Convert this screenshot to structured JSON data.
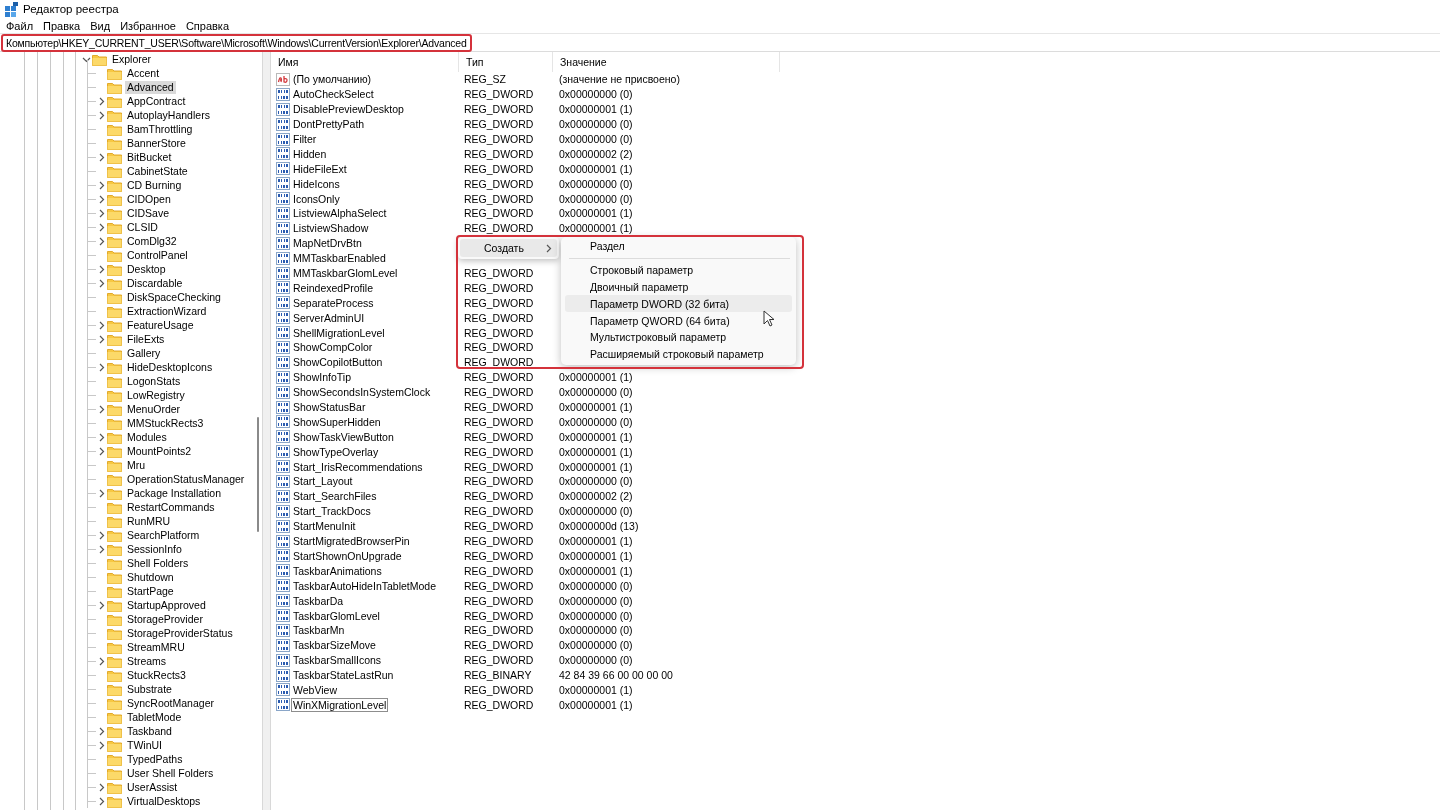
{
  "window": {
    "title": "Редактор реестра"
  },
  "menu": [
    "Файл",
    "Правка",
    "Вид",
    "Избранное",
    "Справка"
  ],
  "address_bar": {
    "path": "Компьютер\\HKEY_CURRENT_USER\\Software\\Microsoft\\Windows\\CurrentVersion\\Explorer\\Advanced",
    "highlighted": true
  },
  "tree": {
    "items": [
      {
        "label": "Explorer",
        "expandable": true,
        "expanded": true,
        "selected": false,
        "children": [
          {
            "label": "Accent",
            "expandable": false,
            "selected": false
          },
          {
            "label": "Advanced",
            "expandable": false,
            "selected": true
          },
          {
            "label": "AppContract",
            "expandable": true,
            "selected": false
          },
          {
            "label": "AutoplayHandlers",
            "expandable": true,
            "selected": false
          },
          {
            "label": "BamThrottling",
            "expandable": false,
            "selected": false
          },
          {
            "label": "BannerStore",
            "expandable": false,
            "selected": false
          },
          {
            "label": "BitBucket",
            "expandable": true,
            "selected": false
          },
          {
            "label": "CabinetState",
            "expandable": false,
            "selected": false
          },
          {
            "label": "CD Burning",
            "expandable": true,
            "selected": false
          },
          {
            "label": "CIDOpen",
            "expandable": true,
            "selected": false
          },
          {
            "label": "CIDSave",
            "expandable": true,
            "selected": false
          },
          {
            "label": "CLSID",
            "expandable": true,
            "selected": false
          },
          {
            "label": "ComDlg32",
            "expandable": true,
            "selected": false
          },
          {
            "label": "ControlPanel",
            "expandable": false,
            "selected": false
          },
          {
            "label": "Desktop",
            "expandable": true,
            "selected": false
          },
          {
            "label": "Discardable",
            "expandable": true,
            "selected": false
          },
          {
            "label": "DiskSpaceChecking",
            "expandable": false,
            "selected": false
          },
          {
            "label": "ExtractionWizard",
            "expandable": false,
            "selected": false
          },
          {
            "label": "FeatureUsage",
            "expandable": true,
            "selected": false
          },
          {
            "label": "FileExts",
            "expandable": true,
            "selected": false
          },
          {
            "label": "Gallery",
            "expandable": false,
            "selected": false
          },
          {
            "label": "HideDesktopIcons",
            "expandable": true,
            "selected": false
          },
          {
            "label": "LogonStats",
            "expandable": false,
            "selected": false
          },
          {
            "label": "LowRegistry",
            "expandable": false,
            "selected": false
          },
          {
            "label": "MenuOrder",
            "expandable": true,
            "selected": false
          },
          {
            "label": "MMStuckRects3",
            "expandable": false,
            "selected": false
          },
          {
            "label": "Modules",
            "expandable": true,
            "selected": false
          },
          {
            "label": "MountPoints2",
            "expandable": true,
            "selected": false
          },
          {
            "label": "Mru",
            "expandable": false,
            "selected": false
          },
          {
            "label": "OperationStatusManager",
            "expandable": false,
            "selected": false
          },
          {
            "label": "Package Installation",
            "expandable": true,
            "selected": false
          },
          {
            "label": "RestartCommands",
            "expandable": false,
            "selected": false
          },
          {
            "label": "RunMRU",
            "expandable": false,
            "selected": false
          },
          {
            "label": "SearchPlatform",
            "expandable": true,
            "selected": false
          },
          {
            "label": "SessionInfo",
            "expandable": true,
            "selected": false
          },
          {
            "label": "Shell Folders",
            "expandable": false,
            "selected": false
          },
          {
            "label": "Shutdown",
            "expandable": false,
            "selected": false
          },
          {
            "label": "StartPage",
            "expandable": false,
            "selected": false
          },
          {
            "label": "StartupApproved",
            "expandable": true,
            "selected": false
          },
          {
            "label": "StorageProvider",
            "expandable": false,
            "selected": false
          },
          {
            "label": "StorageProviderStatus",
            "expandable": false,
            "selected": false
          },
          {
            "label": "StreamMRU",
            "expandable": false,
            "selected": false
          },
          {
            "label": "Streams",
            "expandable": true,
            "selected": false
          },
          {
            "label": "StuckRects3",
            "expandable": false,
            "selected": false
          },
          {
            "label": "Substrate",
            "expandable": false,
            "selected": false
          },
          {
            "label": "SyncRootManager",
            "expandable": false,
            "selected": false
          },
          {
            "label": "TabletMode",
            "expandable": false,
            "selected": false
          },
          {
            "label": "Taskband",
            "expandable": true,
            "selected": false
          },
          {
            "label": "TWinUI",
            "expandable": true,
            "selected": false
          },
          {
            "label": "TypedPaths",
            "expandable": false,
            "selected": false
          },
          {
            "label": "User Shell Folders",
            "expandable": false,
            "selected": false
          },
          {
            "label": "UserAssist",
            "expandable": true,
            "selected": false
          },
          {
            "label": "VirtualDesktops",
            "expandable": true,
            "selected": false
          }
        ]
      }
    ]
  },
  "table": {
    "columns": [
      "Имя",
      "Тип",
      "Значение"
    ],
    "rows": [
      {
        "kind": "string",
        "name": "(По умолчанию)",
        "type": "REG_SZ",
        "value": "(значение не присвоено)",
        "focused": false
      },
      {
        "kind": "binary",
        "name": "AutoCheckSelect",
        "type": "REG_DWORD",
        "value": "0x00000000 (0)",
        "focused": false
      },
      {
        "kind": "binary",
        "name": "DisablePreviewDesktop",
        "type": "REG_DWORD",
        "value": "0x00000001 (1)",
        "focused": false
      },
      {
        "kind": "binary",
        "name": "DontPrettyPath",
        "type": "REG_DWORD",
        "value": "0x00000000 (0)",
        "focused": false
      },
      {
        "kind": "binary",
        "name": "Filter",
        "type": "REG_DWORD",
        "value": "0x00000000 (0)",
        "focused": false
      },
      {
        "kind": "binary",
        "name": "Hidden",
        "type": "REG_DWORD",
        "value": "0x00000002 (2)",
        "focused": false
      },
      {
        "kind": "binary",
        "name": "HideFileExt",
        "type": "REG_DWORD",
        "value": "0x00000001 (1)",
        "focused": false
      },
      {
        "kind": "binary",
        "name": "HideIcons",
        "type": "REG_DWORD",
        "value": "0x00000000 (0)",
        "focused": false
      },
      {
        "kind": "binary",
        "name": "IconsOnly",
        "type": "REG_DWORD",
        "value": "0x00000000 (0)",
        "focused": false
      },
      {
        "kind": "binary",
        "name": "ListviewAlphaSelect",
        "type": "REG_DWORD",
        "value": "0x00000001 (1)",
        "focused": false
      },
      {
        "kind": "binary",
        "name": "ListviewShadow",
        "type": "REG_DWORD",
        "value": "0x00000001 (1)",
        "focused": false
      },
      {
        "kind": "binary",
        "name": "MapNetDrvBtn",
        "focused": false
      },
      {
        "kind": "binary",
        "name": "MMTaskbarEnabled",
        "focused": false
      },
      {
        "kind": "binary",
        "name": "MMTaskbarGlomLevel",
        "type": "REG_DWORD",
        "focused": false
      },
      {
        "kind": "binary",
        "name": "ReindexedProfile",
        "type": "REG_DWORD",
        "focused": false
      },
      {
        "kind": "binary",
        "name": "SeparateProcess",
        "type": "REG_DWORD",
        "focused": false
      },
      {
        "kind": "binary",
        "name": "ServerAdminUI",
        "type": "REG_DWORD",
        "focused": false
      },
      {
        "kind": "binary",
        "name": "ShellMigrationLevel",
        "type": "REG_DWORD",
        "focused": false
      },
      {
        "kind": "binary",
        "name": "ShowCompColor",
        "type": "REG_DWORD",
        "focused": false
      },
      {
        "kind": "binary",
        "name": "ShowCopilotButton",
        "type": "REG_DWORD",
        "focused": false
      },
      {
        "kind": "binary",
        "name": "ShowInfoTip",
        "type": "REG_DWORD",
        "value": "0x00000001 (1)",
        "focused": false
      },
      {
        "kind": "binary",
        "name": "ShowSecondsInSystemClock",
        "type": "REG_DWORD",
        "value": "0x00000000 (0)",
        "focused": false
      },
      {
        "kind": "binary",
        "name": "ShowStatusBar",
        "type": "REG_DWORD",
        "value": "0x00000001 (1)",
        "focused": false
      },
      {
        "kind": "binary",
        "name": "ShowSuperHidden",
        "type": "REG_DWORD",
        "value": "0x00000000 (0)",
        "focused": false
      },
      {
        "kind": "binary",
        "name": "ShowTaskViewButton",
        "type": "REG_DWORD",
        "value": "0x00000001 (1)",
        "focused": false
      },
      {
        "kind": "binary",
        "name": "ShowTypeOverlay",
        "type": "REG_DWORD",
        "value": "0x00000001 (1)",
        "focused": false
      },
      {
        "kind": "binary",
        "name": "Start_IrisRecommendations",
        "type": "REG_DWORD",
        "value": "0x00000001 (1)",
        "focused": false
      },
      {
        "kind": "binary",
        "name": "Start_Layout",
        "type": "REG_DWORD",
        "value": "0x00000000 (0)",
        "focused": false
      },
      {
        "kind": "binary",
        "name": "Start_SearchFiles",
        "type": "REG_DWORD",
        "value": "0x00000002 (2)",
        "focused": false
      },
      {
        "kind": "binary",
        "name": "Start_TrackDocs",
        "type": "REG_DWORD",
        "value": "0x00000000 (0)",
        "focused": false
      },
      {
        "kind": "binary",
        "name": "StartMenuInit",
        "type": "REG_DWORD",
        "value": "0x0000000d (13)",
        "focused": false
      },
      {
        "kind": "binary",
        "name": "StartMigratedBrowserPin",
        "type": "REG_DWORD",
        "value": "0x00000001 (1)",
        "focused": false
      },
      {
        "kind": "binary",
        "name": "StartShownOnUpgrade",
        "type": "REG_DWORD",
        "value": "0x00000001 (1)",
        "focused": false
      },
      {
        "kind": "binary",
        "name": "TaskbarAnimations",
        "type": "REG_DWORD",
        "value": "0x00000001 (1)",
        "focused": false
      },
      {
        "kind": "binary",
        "name": "TaskbarAutoHideInTabletMode",
        "type": "REG_DWORD",
        "value": "0x00000000 (0)",
        "focused": false
      },
      {
        "kind": "binary",
        "name": "TaskbarDa",
        "type": "REG_DWORD",
        "value": "0x00000000 (0)",
        "focused": false
      },
      {
        "kind": "binary",
        "name": "TaskbarGlomLevel",
        "type": "REG_DWORD",
        "value": "0x00000000 (0)",
        "focused": false
      },
      {
        "kind": "binary",
        "name": "TaskbarMn",
        "type": "REG_DWORD",
        "value": "0x00000000 (0)",
        "focused": false
      },
      {
        "kind": "binary",
        "name": "TaskbarSizeMove",
        "type": "REG_DWORD",
        "value": "0x00000000 (0)",
        "focused": false
      },
      {
        "kind": "binary",
        "name": "TaskbarSmallIcons",
        "type": "REG_DWORD",
        "value": "0x00000000 (0)",
        "focused": false
      },
      {
        "kind": "binary",
        "name": "TaskbarStateLastRun",
        "type": "REG_BINARY",
        "value": "42 84 39 66 00 00 00 00",
        "focused": false
      },
      {
        "kind": "binary",
        "name": "WebView",
        "type": "REG_DWORD",
        "value": "0x00000001 (1)",
        "focused": false
      },
      {
        "kind": "binary",
        "name": "WinXMigrationLevel",
        "type": "REG_DWORD",
        "value": "0x00000001 (1)",
        "focused": true
      }
    ]
  },
  "context_menu": {
    "highlighted": true,
    "items": [
      {
        "label": "Создать",
        "submenu": true,
        "selected": true
      }
    ],
    "submenu": [
      {
        "kind": "item",
        "label": "Раздел",
        "selected": false
      },
      {
        "kind": "separator"
      },
      {
        "kind": "item",
        "label": "Строковый параметр",
        "selected": false
      },
      {
        "kind": "item",
        "label": "Двоичный параметр",
        "selected": false
      },
      {
        "kind": "item",
        "label": "Параметр DWORD (32 бита)",
        "selected": true
      },
      {
        "kind": "item",
        "label": "Параметр QWORD (64 бита)",
        "selected": false
      },
      {
        "kind": "item",
        "label": "Мультистроковый параметр",
        "selected": false
      },
      {
        "kind": "item",
        "label": "Расширяемый строковый параметр",
        "selected": false
      }
    ]
  }
}
